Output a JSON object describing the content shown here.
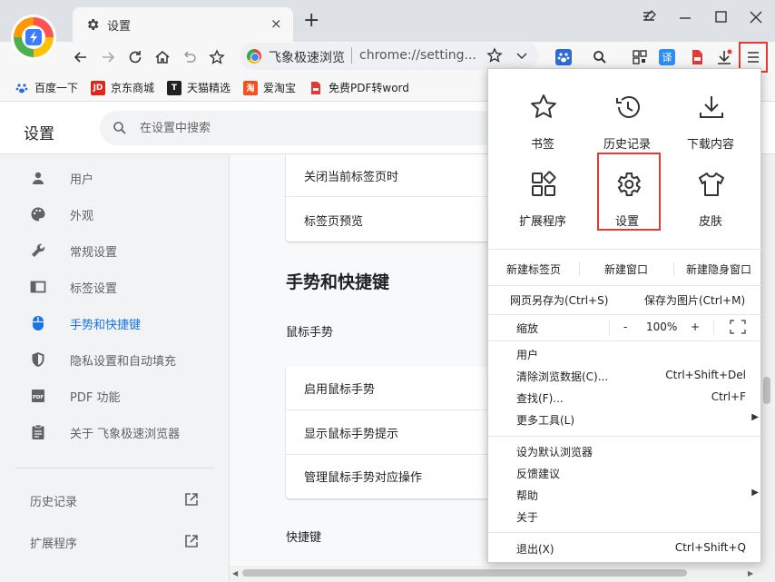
{
  "tab": {
    "title": "设置",
    "close": "×"
  },
  "new_tab": "+",
  "omnibox": {
    "site": "飞象极速浏览",
    "url": "chrome://setting..."
  },
  "bookmarks": [
    {
      "label": "百度一下",
      "icon": "baidu-paw-icon"
    },
    {
      "label": "京东商城",
      "icon": "jd-icon",
      "mark": "JD"
    },
    {
      "label": "天猫精选",
      "icon": "tmall-icon",
      "mark": "T"
    },
    {
      "label": "爱淘宝",
      "icon": "taobao-icon",
      "mark": "淘"
    },
    {
      "label": "免费PDF转word",
      "icon": "pdf-icon"
    }
  ],
  "settings": {
    "title": "设置",
    "search_placeholder": "在设置中搜索",
    "nav": [
      {
        "label": "用户",
        "icon": "person-icon"
      },
      {
        "label": "外观",
        "icon": "palette-icon"
      },
      {
        "label": "常规设置",
        "icon": "wrench-icon"
      },
      {
        "label": "标签设置",
        "icon": "tab-icon"
      },
      {
        "label": "手势和快捷键",
        "icon": "mouse-icon",
        "active": true
      },
      {
        "label": "隐私设置和自动填充",
        "icon": "shield-icon"
      },
      {
        "label": "PDF 功能",
        "icon": "pdf-icon"
      },
      {
        "label": "关于 飞象极速浏览器",
        "icon": "clipboard-icon"
      }
    ],
    "links": [
      {
        "label": "历史记录",
        "icon": "external-link-icon"
      },
      {
        "label": "扩展程序",
        "icon": "external-link-icon"
      }
    ]
  },
  "content": {
    "tab_card": [
      "关闭当前标签页时",
      "标签页预览"
    ],
    "section_title": "手势和快捷键",
    "mouse_gesture_title": "鼠标手势",
    "gesture_card": [
      "启用鼠标手势",
      "显示鼠标手势提示",
      "管理鼠标手势对应操作"
    ],
    "shortcut_title": "快捷键"
  },
  "menu": {
    "grid": [
      {
        "label": "书签",
        "icon": "star-icon"
      },
      {
        "label": "历史记录",
        "icon": "history-icon"
      },
      {
        "label": "下载内容",
        "icon": "download-icon"
      },
      {
        "label": "扩展程序",
        "icon": "extensions-icon"
      },
      {
        "label": "设置",
        "icon": "gear-icon"
      },
      {
        "label": "皮肤",
        "icon": "tshirt-icon"
      }
    ],
    "new_tab": "新建标签页",
    "new_window": "新建窗口",
    "new_incognito": "新建隐身窗口",
    "save_page": "网页另存为(Ctrl+S)",
    "save_image": "保存为图片(Ctrl+M)",
    "zoom_label": "缩放",
    "zoom_minus": "-",
    "zoom_value": "100%",
    "zoom_plus": "+",
    "items_group1": [
      {
        "label": "用户",
        "shortcut": ""
      },
      {
        "label": "清除浏览数据(C)...",
        "shortcut": "Ctrl+Shift+Del"
      },
      {
        "label": "查找(F)...",
        "shortcut": "Ctrl+F"
      },
      {
        "label": "更多工具(L)",
        "shortcut": "",
        "submenu": true
      }
    ],
    "items_group2": [
      {
        "label": "设为默认浏览器",
        "shortcut": ""
      },
      {
        "label": "反馈建议",
        "shortcut": ""
      },
      {
        "label": "帮助",
        "shortcut": "",
        "submenu": true
      },
      {
        "label": "关于",
        "shortcut": ""
      }
    ],
    "exit": {
      "label": "退出(X)",
      "shortcut": "Ctrl+Shift+Q"
    },
    "submenu_arrow": "▶"
  },
  "colors": {
    "accent": "#1a73e8",
    "highlight": "#e53935"
  }
}
